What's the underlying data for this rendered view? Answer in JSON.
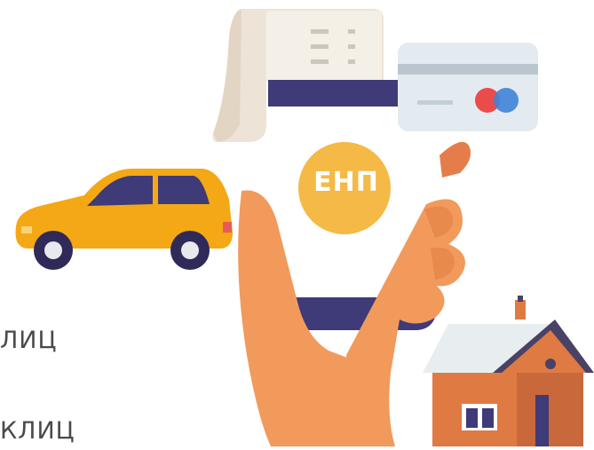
{
  "illustration": {
    "badge_label": "ЕНП",
    "side_text_line1": "ЛИЦ",
    "side_text_line2": "КЛИЦ"
  },
  "colors": {
    "car_body": "#f5a815",
    "hand": "#f19a5c",
    "phone_band": "#3f3a78",
    "badge": "#f5b946",
    "card": "#e6edf1",
    "house_wall": "#e07a43",
    "roof": "#4a4266"
  },
  "icons": [
    "receipt-icon",
    "credit-card-icon",
    "car-icon",
    "phone-icon",
    "hand-icon",
    "house-icon"
  ]
}
